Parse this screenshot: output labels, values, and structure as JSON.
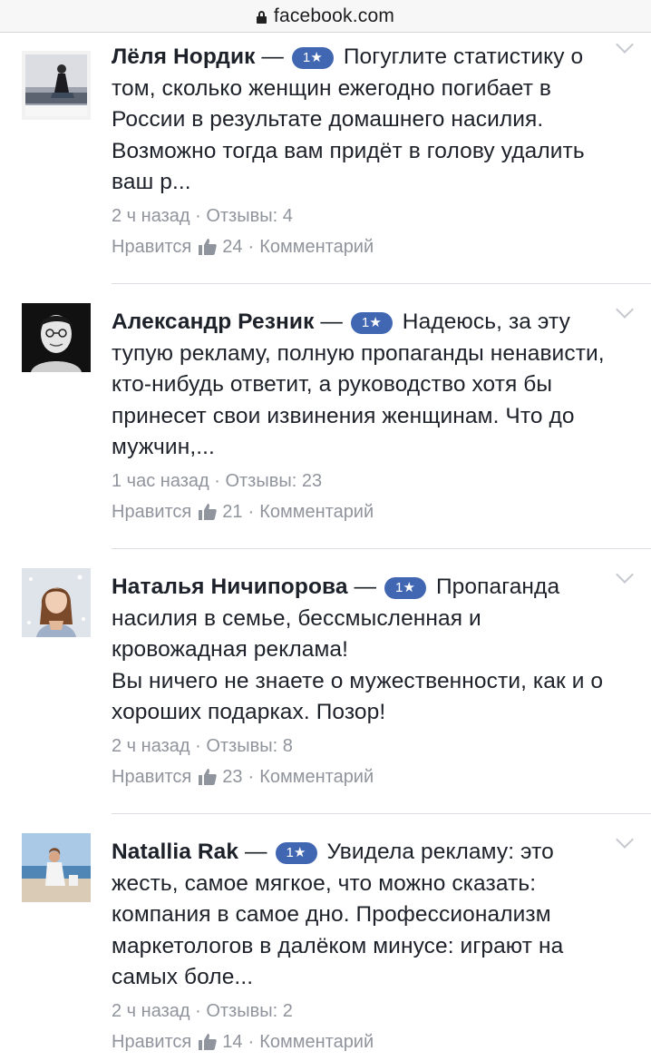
{
  "browser": {
    "domain": "facebook.com"
  },
  "comments": [
    {
      "author": "Лёля Нордик",
      "dash": " —",
      "badge": "1★",
      "text": "Погуглите статистику о том, сколько женщин ежегодно погибает в России в результате домашнего насилия. Возможно тогда вам придёт в голову удалить ваш р...",
      "time": "2 ч назад",
      "replies": "Отзывы: 4",
      "like_label": "Нравится",
      "likes": "24",
      "comment_label": "Комментарий"
    },
    {
      "author": "Александр Резник",
      "dash": " —",
      "badge": "1★",
      "text": "Надеюсь, за эту тупую рекламу, полную пропаганды ненависти, кто-нибудь ответит, а руководство хотя бы принесет свои извинения женщинам. Что до мужчин,...",
      "time": "1 час назад",
      "replies": "Отзывы: 23",
      "like_label": "Нравится",
      "likes": "21",
      "comment_label": "Комментарий"
    },
    {
      "author": "Наталья Ничипорова",
      "dash": " —",
      "badge": "1★",
      "text": "Пропаганда насилия в семье, бессмысленная и кровожадная реклама!",
      "text2": "Вы ничего не знаете о мужественности, как и о хороших подарках. Позор!",
      "time": "2 ч назад",
      "replies": "Отзывы: 8",
      "like_label": "Нравится",
      "likes": "23",
      "comment_label": "Комментарий"
    },
    {
      "author": "Natallia Rak",
      "dash": " —",
      "badge": "1★",
      "text": "Увидела рекламу: это жесть, самое мягкое, что можно сказать: компания в самое дно. Профессионализм маркетологов в далёком минусе: играют на самых боле...",
      "time": "2 ч назад",
      "replies": "Отзывы: 2",
      "like_label": "Нравится",
      "likes": "14",
      "comment_label": "Комментарий"
    }
  ],
  "meta_separator": " · ",
  "colors": {
    "badge": "#4267b2",
    "meta": "#90949c",
    "text": "#1d2129"
  }
}
